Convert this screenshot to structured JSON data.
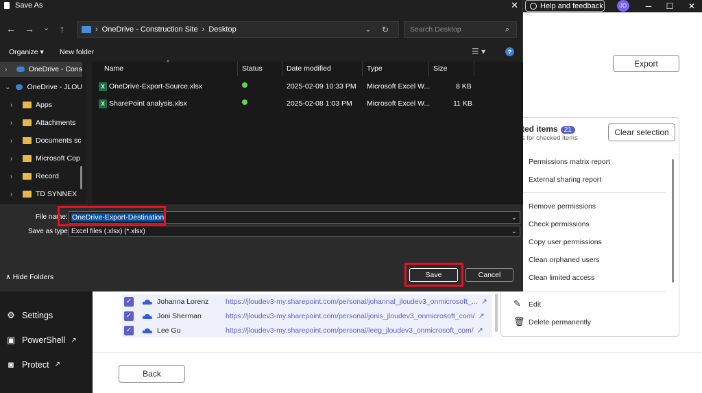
{
  "dialog": {
    "title": "Save As",
    "close_glyph": "✕",
    "nav": {
      "back_glyph": "←",
      "forward_glyph": "→",
      "recent_glyph": "⌄",
      "up_glyph": "↑"
    },
    "address": {
      "segment1": "OneDrive - Construction Site",
      "segment2": "Desktop",
      "sep": "›"
    },
    "search_placeholder": "Search Desktop",
    "toolbar": {
      "organize": "Organize ▾",
      "new_folder": "New folder",
      "help_glyph": "?"
    },
    "tree": [
      {
        "label": "OneDrive - Cons",
        "icon": "cloud-icon",
        "chev": "›"
      },
      {
        "label": "OneDrive - JLOU",
        "icon": "cloud-icon",
        "chev": "⌄"
      },
      {
        "label": "Apps",
        "icon": "folder-icon",
        "chev": "›"
      },
      {
        "label": "Attachments",
        "icon": "folder-icon",
        "chev": "›"
      },
      {
        "label": "Documents sc",
        "icon": "folder-icon",
        "chev": "›"
      },
      {
        "label": "Microsoft Cop",
        "icon": "folder-icon",
        "chev": "›"
      },
      {
        "label": "Record",
        "icon": "folder-icon",
        "chev": "›"
      },
      {
        "label": "TD SYNNEX",
        "icon": "folder-icon",
        "chev": "›"
      }
    ],
    "columns": {
      "name": "Name",
      "status": "Status",
      "date": "Date modified",
      "type": "Type",
      "size": "Size"
    },
    "files": [
      {
        "name": "OneDrive-Export-Source.xlsx",
        "date": "2025-02-09 10:33 PM",
        "type": "Microsoft Excel W...",
        "size": "8 KB"
      },
      {
        "name": "SharePoint analysis.xlsx",
        "date": "2025-02-08 1:03 PM",
        "type": "Microsoft Excel W...",
        "size": "11 KB"
      }
    ],
    "file_name_label": "File name:",
    "file_name_value": "OneDrive-Export-Destination",
    "save_type_label": "Save as type:",
    "save_type_value": "Excel files (.xlsx) (*.xlsx)",
    "hide_folders": "Hide Folders",
    "save": "Save",
    "cancel": "Cancel"
  },
  "app": {
    "help_feedback": "Help and feedback",
    "avatar": "JO",
    "export": "Export",
    "selected_title": "ted items",
    "selected_count": "21",
    "selected_sub": "s for checked items",
    "clear_selection": "Clear selection",
    "actions": [
      "Permissions matrix report",
      "External sharing report",
      "Remove permissions",
      "Check permissions",
      "Copy user permissions",
      "Clean orphaned users",
      "Clean limited access",
      "Edit",
      "Delete permanently"
    ],
    "rows": [
      {
        "name": "Johanna Lorenz",
        "url": "https://jloudev3-my.sharepoint.com/personal/johannal_jloudev3_onmicrosoft_..."
      },
      {
        "name": "Joni Sherman",
        "url": "https://jloudev3-my.sharepoint.com/personal/jonis_jloudev3_onmicrosoft_com/"
      },
      {
        "name": "Lee Gu",
        "url": "https://jloudev3-my.sharepoint.com/personal/leeg_jloudev3_onmicrosoft_com/"
      }
    ],
    "nav": {
      "settings": "Settings",
      "powershell": "PowerShell",
      "protect": "Protect"
    },
    "back": "Back"
  }
}
